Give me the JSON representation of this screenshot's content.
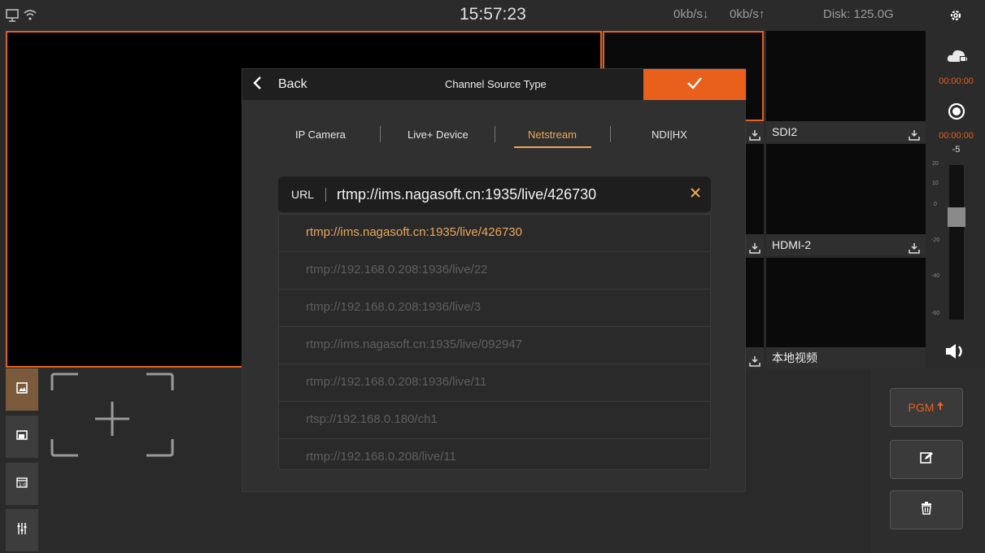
{
  "status": {
    "time": "15:57:23",
    "download": "0kb/s↓",
    "upload": "0kb/s↑",
    "disk": "Disk:  125.0G"
  },
  "channels": [
    {
      "label": ""
    },
    {
      "label": "SDI2"
    },
    {
      "label": ""
    },
    {
      "label": "HDMI-2"
    },
    {
      "label": ""
    },
    {
      "label": "本地视频"
    }
  ],
  "right_panel": {
    "stream_time": "00:00:00",
    "record_time": "00:00:00",
    "level": "-5",
    "meter_ticks": [
      "20",
      "10",
      "0",
      "-20",
      "-40",
      "-60"
    ]
  },
  "bottom": {
    "pgm_label": "PGM"
  },
  "dialog": {
    "back_label": "Back",
    "title": "Channel Source Type",
    "tabs": [
      "IP Camera",
      "Live+ Device",
      "Netstream",
      "NDI|HX"
    ],
    "active_tab": "Netstream",
    "url_label": "URL",
    "url_value": "rtmp://ims.nagasoft.cn:1935/live/426730",
    "history": [
      "rtmp://ims.nagasoft.cn:1935/live/426730",
      "rtmp://192.168.0.208:1936/live/22",
      "rtmp://192.168.0.208:1936/live/3",
      "rtmp://ims.nagasoft.cn:1935/live/092947",
      "rtmp://192.168.0.208:1936/live/11",
      "rtsp://192.168.0.180/ch1",
      "rtmp://192.168.0.208/live/11"
    ]
  },
  "colors": {
    "accent": "#e8601c",
    "active_text": "#e9a75a"
  }
}
